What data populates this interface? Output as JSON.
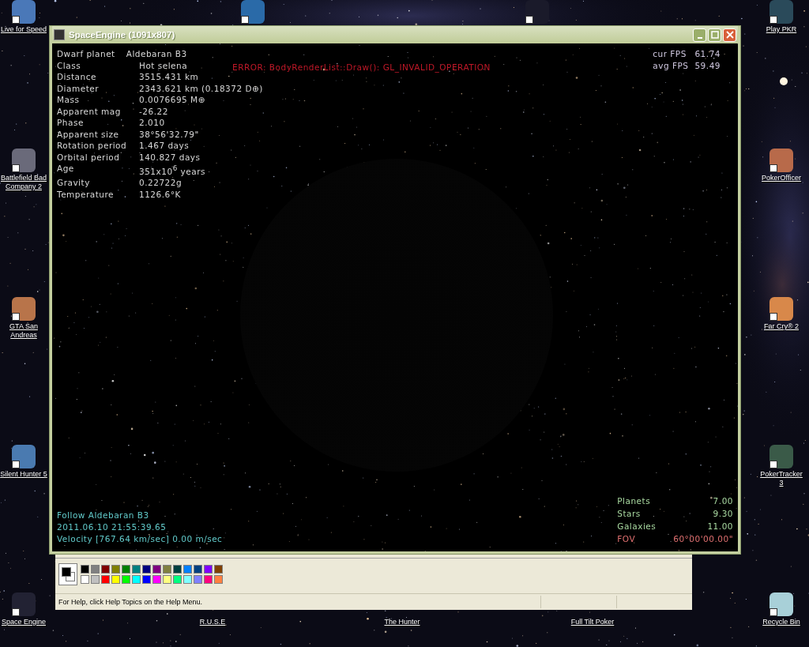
{
  "desktop": {
    "icons": [
      {
        "label": "Live for Speed"
      },
      {
        "label": "Play PKR"
      },
      {
        "label": "Battlefield Bad Company 2"
      },
      {
        "label": "PokerOfficer"
      },
      {
        "label": "GTA San Andreas"
      },
      {
        "label": "Far Cry® 2"
      },
      {
        "label": "Silent Hunter 5"
      },
      {
        "label": "PokerTracker 3"
      },
      {
        "label": "Space Engine"
      },
      {
        "label": "R.U.S.E"
      },
      {
        "label": "The Hunter"
      },
      {
        "label": "Full Tilt Poker"
      },
      {
        "label": "Recycle Bin"
      }
    ]
  },
  "window": {
    "title": "SpaceEngine (1091x807)",
    "object": {
      "type": "Dwarf planet",
      "name": "Aldebaran B3"
    },
    "info": [
      {
        "label": "Class",
        "value": "Hot selena"
      },
      {
        "label": "Distance",
        "value": "3515.431 km"
      },
      {
        "label": "Diameter",
        "value": "2343.621 km (0.18372 D⊕)"
      },
      {
        "label": "Mass",
        "value": "0.0076695 M⊕"
      },
      {
        "label": "Apparent mag",
        "value": "-26.22"
      },
      {
        "label": "Phase",
        "value": "2.010"
      },
      {
        "label": "Apparent size",
        "value": "38°56'32.79\""
      },
      {
        "label": "Rotation period",
        "value": "1.467 days"
      },
      {
        "label": "Orbital period",
        "value": "140.827 days"
      },
      {
        "label": "Age",
        "value": "351x10$^{6}$ years"
      },
      {
        "label": "Gravity",
        "value": "0.22722g"
      },
      {
        "label": "Temperature",
        "value": "1126.6°K"
      }
    ],
    "error": "ERROR: BodyRenderList::Draw(): GL_INVALID_OPERATION",
    "fps": [
      {
        "label": "cur FPS",
        "value": "61.74"
      },
      {
        "label": "avg FPS",
        "value": "59.49"
      }
    ],
    "follow": "Follow Aldebaran B3",
    "datetime": "2011.06.10 21:55:39.65",
    "velocity": "Velocity [767.64 km/sec] 0.00 m/sec",
    "counts": [
      {
        "label": "Planets",
        "value": "7.00"
      },
      {
        "label": "Stars",
        "value": "9.30"
      },
      {
        "label": "Galaxies",
        "value": "11.00"
      }
    ],
    "fov": {
      "label": "FOV",
      "value": "60°00'00.00\""
    }
  },
  "paint": {
    "palette": [
      {
        "color": "#000000"
      },
      {
        "color": "#808080"
      },
      {
        "color": "#800000"
      },
      {
        "color": "#808000"
      },
      {
        "color": "#008000"
      },
      {
        "color": "#008080"
      },
      {
        "color": "#000080"
      },
      {
        "color": "#800080"
      },
      {
        "color": "#808040"
      },
      {
        "color": "#004040"
      },
      {
        "color": "#0080ff"
      },
      {
        "color": "#004080"
      },
      {
        "color": "#8000ff"
      },
      {
        "color": "#804000"
      },
      {
        "color": "#ffffff"
      },
      {
        "color": "#c0c0c0"
      },
      {
        "color": "#ff0000"
      },
      {
        "color": "#ffff00"
      },
      {
        "color": "#00ff00"
      },
      {
        "color": "#00ffff"
      },
      {
        "color": "#0000ff"
      },
      {
        "color": "#ff00ff"
      },
      {
        "color": "#ffff80"
      },
      {
        "color": "#00ff80"
      },
      {
        "color": "#80ffff"
      },
      {
        "color": "#8080ff"
      },
      {
        "color": "#ff0080"
      },
      {
        "color": "#ff8040"
      }
    ],
    "status": "For Help, click Help Topics on the Help Menu."
  }
}
